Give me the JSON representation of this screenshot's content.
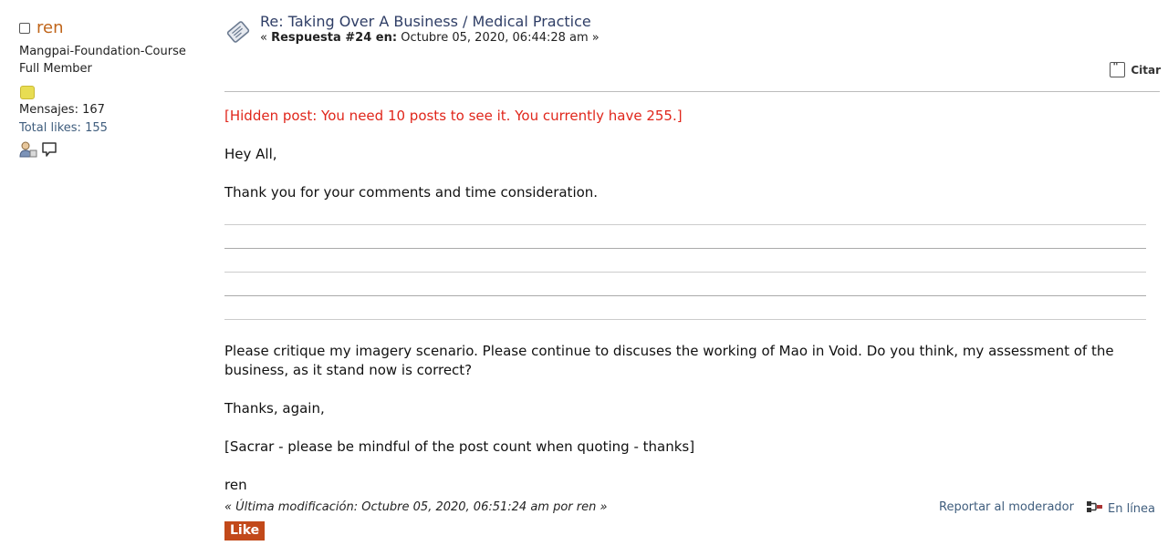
{
  "poster": {
    "username": "ren",
    "group_primary": "Mangpai-Foundation-Course",
    "group_secondary": "Full Member",
    "posts": "Mensajes: 167",
    "likes": "Total likes: 155"
  },
  "post": {
    "subject": "Re: Taking Over A Business / Medical Practice",
    "meta_prefix": "« ",
    "meta_bold": "Respuesta #24 en:",
    "meta_date": " Octubre 05, 2020, 06:44:28 am »",
    "quote_label": "Citar",
    "hidden_note": "[Hidden post: You need 10 posts to see it. You currently have 255.]",
    "greeting": "Hey All,",
    "thanks_line": "Thank you for your comments and time consideration.",
    "critique": "Please critique my imagery scenario. Please continue to discuses the working of Mao in Void. Do you think, my assessment of the business, as it stand now is correct?",
    "thanks_again": "Thanks, again,",
    "mod_note": "[Sacrar - please be mindful of the post count when quoting - thanks]",
    "signoff": "ren",
    "modified": "« Última modificación: Octubre 05, 2020, 06:51:24 am por ren »",
    "report_label": "Reportar al moderador",
    "online_label": "En línea",
    "like_label": "Like"
  }
}
